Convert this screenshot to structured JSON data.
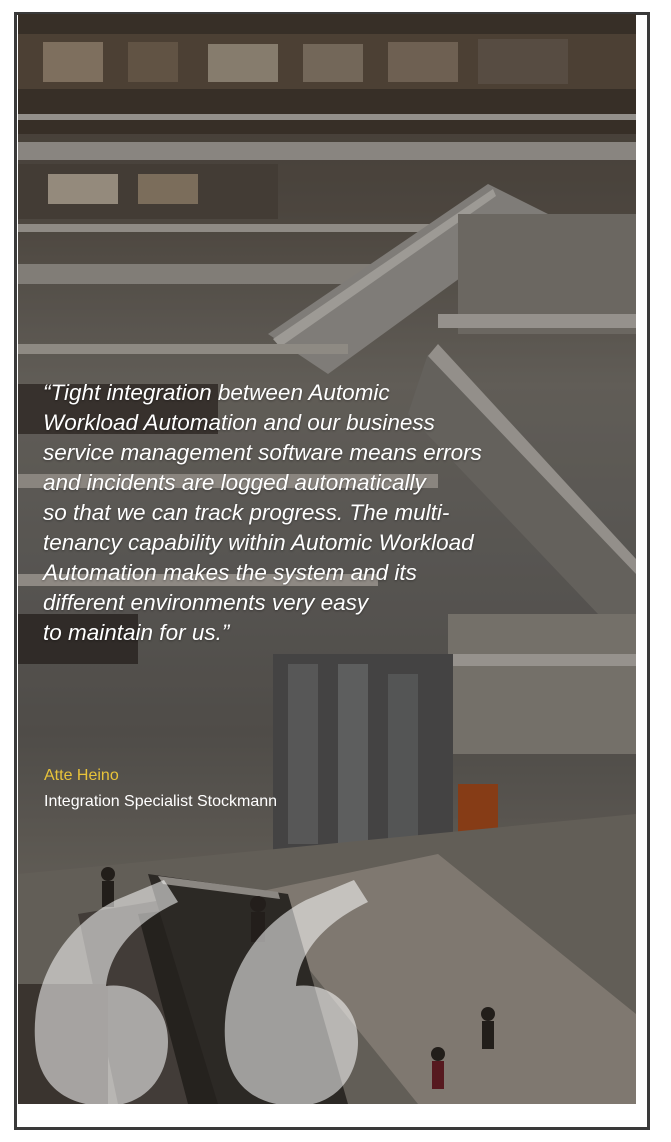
{
  "testimonial": {
    "quote_lines": [
      "“Tight integration between Automic",
      "Workload Automation and our business",
      "service management software means errors",
      "and incidents are logged automatically",
      "so that we can track progress. The multi-",
      "tenancy capability within Automic Workload",
      "Automation makes the system and its",
      "different environments very easy",
      "to maintain for us.”"
    ],
    "author_name": "Atte Heino",
    "author_role": "Integration Specialist Stockmann"
  },
  "colors": {
    "author_accent": "#e8c33a",
    "quote_text": "#ffffff",
    "frame_border": "#3a3a3a"
  },
  "icons": {
    "decorative_mark": "quotation-mark-icon"
  }
}
